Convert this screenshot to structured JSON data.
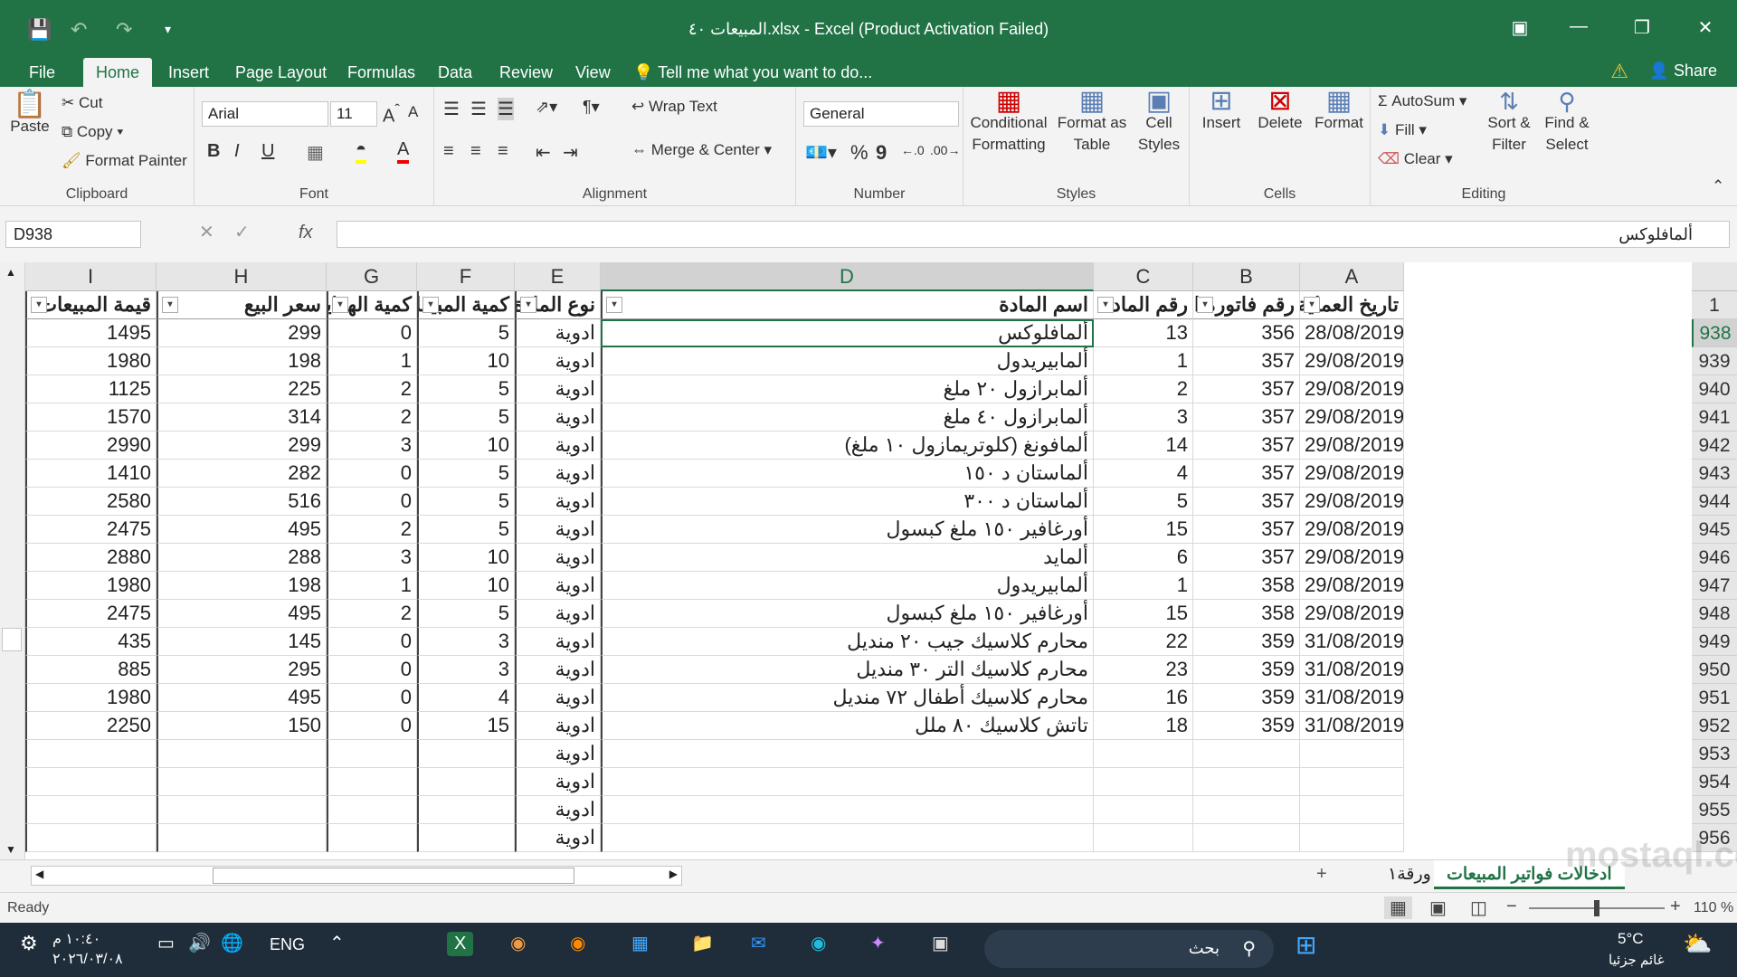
{
  "window": {
    "title": "المبيعات ٤٠.xlsx - Excel (Product Activation Failed)",
    "share": "Share",
    "tell_me": "Tell me what you want to do..."
  },
  "tabs": [
    "File",
    "Home",
    "Insert",
    "Page Layout",
    "Formulas",
    "Data",
    "Review",
    "View"
  ],
  "ribbon": {
    "clipboard": {
      "paste": "Paste",
      "cut": "Cut",
      "copy": "Copy",
      "format_painter": "Format Painter",
      "label": "Clipboard"
    },
    "font": {
      "name": "Arial",
      "size": "11",
      "label": "Font",
      "bold": "B",
      "italic": "I",
      "underline": "U"
    },
    "alignment": {
      "wrap": "Wrap Text",
      "merge": "Merge & Center",
      "label": "Alignment"
    },
    "number": {
      "format": "General",
      "label": "Number",
      "percent": "%",
      "comma": "9"
    },
    "styles": {
      "conditional": "Conditional Formatting",
      "format_table": "Format as Table",
      "cell_styles": "Cell Styles",
      "label": "Styles"
    },
    "cells": {
      "insert": "Insert",
      "delete": "Delete",
      "format": "Format",
      "label": "Cells"
    },
    "editing": {
      "autosum": "AutoSum",
      "fill": "Fill",
      "clear": "Clear",
      "sort": "Sort & Filter",
      "find": "Find & Select",
      "label": "Editing"
    }
  },
  "formula_bar": {
    "name_box": "D938",
    "content": "ألمافلوكس",
    "fx": "fx"
  },
  "columns": [
    "I",
    "H",
    "G",
    "F",
    "E",
    "D",
    "C",
    "B",
    "A"
  ],
  "headers": {
    "A": "تاريخ العملية",
    "B": "رقم فاتورة البيع",
    "C": "رقم المادة",
    "D": "اسم المادة",
    "E": "نوع المادة",
    "F": "كمية المبيعات",
    "G": "كمية الهدايا",
    "H": "سعر البيع",
    "I": "قيمة المبيعات"
  },
  "header_row_number": "1",
  "rows": [
    {
      "n": "938",
      "A": "28/08/2019",
      "B": "356",
      "C": "13",
      "D": "ألمافلوكس",
      "E": "ادوية",
      "F": "5",
      "G": "0",
      "H": "299",
      "I": "1495"
    },
    {
      "n": "939",
      "A": "29/08/2019",
      "B": "357",
      "C": "1",
      "D": "ألمابيريدول",
      "E": "ادوية",
      "F": "10",
      "G": "1",
      "H": "198",
      "I": "1980"
    },
    {
      "n": "940",
      "A": "29/08/2019",
      "B": "357",
      "C": "2",
      "D": "ألمابرازول ٢٠ ملغ",
      "E": "ادوية",
      "F": "5",
      "G": "2",
      "H": "225",
      "I": "1125"
    },
    {
      "n": "941",
      "A": "29/08/2019",
      "B": "357",
      "C": "3",
      "D": "ألمابرازول ٤٠ ملغ",
      "E": "ادوية",
      "F": "5",
      "G": "2",
      "H": "314",
      "I": "1570"
    },
    {
      "n": "942",
      "A": "29/08/2019",
      "B": "357",
      "C": "14",
      "D": "ألمافونغ (كلوتريمازول ١٠ ملغ)",
      "E": "ادوية",
      "F": "10",
      "G": "3",
      "H": "299",
      "I": "2990"
    },
    {
      "n": "943",
      "A": "29/08/2019",
      "B": "357",
      "C": "4",
      "D": "ألماستان د ١٥٠",
      "E": "ادوية",
      "F": "5",
      "G": "0",
      "H": "282",
      "I": "1410"
    },
    {
      "n": "944",
      "A": "29/08/2019",
      "B": "357",
      "C": "5",
      "D": "ألماستان د ٣٠٠",
      "E": "ادوية",
      "F": "5",
      "G": "0",
      "H": "516",
      "I": "2580"
    },
    {
      "n": "945",
      "A": "29/08/2019",
      "B": "357",
      "C": "15",
      "D": "أورغافير ١٥٠ ملغ كبسول",
      "E": "ادوية",
      "F": "5",
      "G": "2",
      "H": "495",
      "I": "2475"
    },
    {
      "n": "946",
      "A": "29/08/2019",
      "B": "357",
      "C": "6",
      "D": "ألمايد",
      "E": "ادوية",
      "F": "10",
      "G": "3",
      "H": "288",
      "I": "2880"
    },
    {
      "n": "947",
      "A": "29/08/2019",
      "B": "358",
      "C": "1",
      "D": "ألمابيريدول",
      "E": "ادوية",
      "F": "10",
      "G": "1",
      "H": "198",
      "I": "1980"
    },
    {
      "n": "948",
      "A": "29/08/2019",
      "B": "358",
      "C": "15",
      "D": "أورغافير ١٥٠ ملغ كبسول",
      "E": "ادوية",
      "F": "5",
      "G": "2",
      "H": "495",
      "I": "2475"
    },
    {
      "n": "949",
      "A": "31/08/2019",
      "B": "359",
      "C": "22",
      "D": "محارم كلاسيك جيب ٢٠ منديل",
      "E": "ادوية",
      "F": "3",
      "G": "0",
      "H": "145",
      "I": "435"
    },
    {
      "n": "950",
      "A": "31/08/2019",
      "B": "359",
      "C": "23",
      "D": "محارم كلاسيك التر ٣٠ منديل",
      "E": "ادوية",
      "F": "3",
      "G": "0",
      "H": "295",
      "I": "885"
    },
    {
      "n": "951",
      "A": "31/08/2019",
      "B": "359",
      "C": "16",
      "D": "محارم كلاسيك أطفال ٧٢ منديل",
      "E": "ادوية",
      "F": "4",
      "G": "0",
      "H": "495",
      "I": "1980"
    },
    {
      "n": "952",
      "A": "31/08/2019",
      "B": "359",
      "C": "18",
      "D": "تاتش كلاسيك ٨٠ ملل",
      "E": "ادوية",
      "F": "15",
      "G": "0",
      "H": "150",
      "I": "2250"
    },
    {
      "n": "953",
      "A": "",
      "B": "",
      "C": "",
      "D": "",
      "E": "ادوية",
      "F": "",
      "G": "",
      "H": "",
      "I": ""
    },
    {
      "n": "954",
      "A": "",
      "B": "",
      "C": "",
      "D": "",
      "E": "ادوية",
      "F": "",
      "G": "",
      "H": "",
      "I": ""
    },
    {
      "n": "955",
      "A": "",
      "B": "",
      "C": "",
      "D": "",
      "E": "ادوية",
      "F": "",
      "G": "",
      "H": "",
      "I": ""
    },
    {
      "n": "956",
      "A": "",
      "B": "",
      "C": "",
      "D": "",
      "E": "ادوية",
      "F": "",
      "G": "",
      "H": "",
      "I": ""
    }
  ],
  "sheets": {
    "active": "ادخالات فواتير المبيعات",
    "other": "ورقة١",
    "add": "+"
  },
  "status": {
    "ready": "Ready",
    "zoom": "110 %"
  },
  "taskbar": {
    "time": "١٠:٤٠ م",
    "date": "٢٠٢٦/٠٣/٠٨",
    "lang": "ENG",
    "search": "بحث",
    "weather_temp": "5°C",
    "weather_desc": "غائم جزئيا"
  },
  "watermark": "mostaql.com",
  "colors": {
    "excel_green": "#217346",
    "taskbar": "#1f2d3a"
  }
}
